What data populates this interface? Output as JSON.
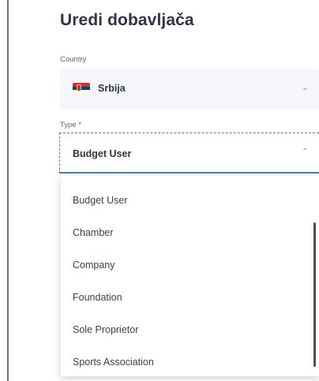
{
  "page": {
    "title": "Uredi dobavljača"
  },
  "country": {
    "label": "Country",
    "value": "Srbija",
    "flag_colors": [
      "#c6363c",
      "#0c4077",
      "#ffffff"
    ]
  },
  "type": {
    "label": "Type *",
    "value": "Budget User",
    "options": [
      "Budget User",
      "Chamber",
      "Company",
      "Foundation",
      "Sole Proprietor",
      "Sports Association"
    ]
  },
  "icons": {
    "country_chevron": "chevron-down-icon",
    "type_chevron": "chevron-up-icon"
  },
  "colors": {
    "focus": "#3a82c4"
  }
}
